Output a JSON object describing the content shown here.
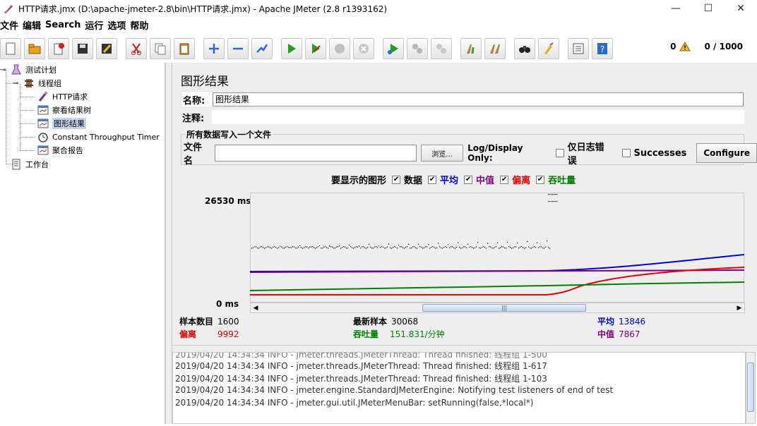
{
  "window": {
    "title": "HTTP请求.jmx (D:\\apache-jmeter-2.8\\bin\\HTTP请求.jmx) - Apache JMeter (2.8 r1393162)",
    "minimize": "—",
    "maximize": "☐",
    "close": "✕"
  },
  "menu": [
    "文件",
    "编辑",
    "Search",
    "运行",
    "选项",
    "帮助"
  ],
  "toolbar": {
    "buttons": [
      "new-icon",
      "open-icon",
      "close-file-icon",
      "save-icon",
      "save-as-icon",
      "cut-icon",
      "copy-icon",
      "paste-icon",
      "expand-icon",
      "collapse-icon",
      "toggle-icon",
      "start-icon",
      "start-no-pause-icon",
      "stop-icon",
      "shutdown-icon",
      "remote-start-icon",
      "remote-stop-icon",
      "remote-exit-icon",
      "clear-icon",
      "clear-all-icon",
      "search-icon",
      "reset-search-icon",
      "function-helper-icon",
      "help-icon"
    ],
    "error_count": "0",
    "threads": "0 / 1000"
  },
  "tree": {
    "nodes": [
      {
        "label": "测试计划",
        "icon": "test-plan-icon"
      },
      {
        "label": "线程组",
        "icon": "thread-group-icon"
      },
      {
        "label": "HTTP请求",
        "icon": "sampler-icon"
      },
      {
        "label": "察看结果树",
        "icon": "listener-icon"
      },
      {
        "label": "图形结果",
        "icon": "listener-icon"
      },
      {
        "label": "Constant Throughput Timer",
        "icon": "timer-icon"
      },
      {
        "label": "聚合报告",
        "icon": "listener-icon"
      },
      {
        "label": "工作台",
        "icon": "workbench-icon"
      }
    ]
  },
  "panel": {
    "title": "图形结果",
    "name_label": "名称:",
    "name_value": "图形结果",
    "comment_label": "注释:",
    "file_group_title": "所有数据写入一个文件",
    "file_label": "文件名",
    "browse": "浏览...",
    "log_display": "Log/Display Only:",
    "errors_only": "仅日志错误",
    "successes": "Successes",
    "configure": "Configure",
    "graphs_label": "要显示的图形",
    "graph_data": "数据",
    "graph_average": "平均",
    "graph_median": "中值",
    "graph_deviation": "偏离",
    "graph_throughput": "吞吐量"
  },
  "colors": {
    "data": "#000000",
    "average": "#0000c8",
    "median": "#800080",
    "deviation": "#e00000",
    "throughput": "#008000"
  },
  "chart_data": {
    "type": "line",
    "y_max_label": "26530 ms",
    "y_min_label": "0 ms",
    "ylim": [
      0,
      26530
    ],
    "series": [
      {
        "name": "平均",
        "x": [
          0,
          420,
          700
        ],
        "y": [
          13846,
          13846,
          14000
        ]
      },
      {
        "name": "中值",
        "x": [
          0,
          700
        ],
        "y": [
          7867,
          7867
        ]
      },
      {
        "name": "偏离",
        "x": [
          0,
          420,
          700
        ],
        "y": [
          9992,
          9992,
          9992
        ]
      },
      {
        "name": "吞吐量",
        "x": [
          0,
          700
        ],
        "y": [
          151.831,
          151.831
        ]
      }
    ]
  },
  "stats": {
    "samples_label": "样本数目",
    "samples": "1600",
    "latest_label": "最新样本",
    "latest": "30068",
    "average_label": "平均",
    "average": "13846",
    "deviation_label": "偏离",
    "deviation": "9992",
    "throughput_label": "吞吐量",
    "throughput": "151.831/分钟",
    "median_label": "中值",
    "median": "7867"
  },
  "log": [
    "2019/04/20 14:34:34 INFO  - jmeter.threads.JMeterThread: Thread finished: 线程组 1-617",
    "2019/04/20 14:34:34 INFO  - jmeter.threads.JMeterThread: Thread finished: 线程组 1-103",
    "2019/04/20 14:34:34 INFO  - jmeter.engine.StandardJMeterEngine: Notifying test listeners of end of test",
    "2019/04/20 14:34:34 INFO  - jmeter.gui.util.JMeterMenuBar: setRunning(false,*local*)"
  ]
}
